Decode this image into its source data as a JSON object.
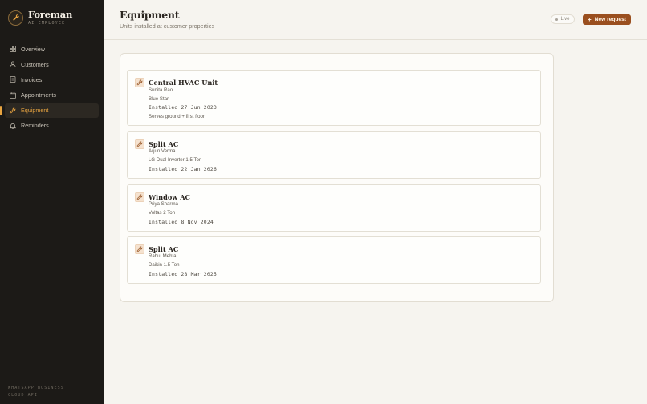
{
  "brand": {
    "name": "Foreman",
    "tagline": "AI EMPLOYEE"
  },
  "nav": [
    {
      "label": "Overview",
      "icon": "grid-icon",
      "active": false
    },
    {
      "label": "Customers",
      "icon": "user-icon",
      "active": false
    },
    {
      "label": "Invoices",
      "icon": "invoice-icon",
      "active": false
    },
    {
      "label": "Appointments",
      "icon": "calendar-icon",
      "active": false
    },
    {
      "label": "Equipment",
      "icon": "wrench-icon",
      "active": true
    },
    {
      "label": "Reminders",
      "icon": "bell-icon",
      "active": false
    }
  ],
  "footer": {
    "line1": "WHATSAPP BUSINESS",
    "line2": "CLOUD API"
  },
  "header": {
    "title": "Equipment",
    "subtitle": "Units installed at customer properties",
    "live_label": "Live",
    "new_request_label": "New request"
  },
  "equipment": [
    {
      "name": "Central HVAC Unit",
      "customer": "Sunita Rao",
      "model": "Blue Star",
      "installed": "Installed 27 Jun 2023",
      "note": "Serves ground + first floor"
    },
    {
      "name": "Split AC",
      "customer": "Arjun Verma",
      "model": "LG Dual Inverter 1.5 Ton",
      "installed": "Installed 22 Jan 2026",
      "note": ""
    },
    {
      "name": "Window AC",
      "customer": "Priya Sharma",
      "model": "Voltas 2 Ton",
      "installed": "Installed 8 Nov 2024",
      "note": ""
    },
    {
      "name": "Split AC",
      "customer": "Rahul Mehta",
      "model": "Daikin 1.5 Ton",
      "installed": "Installed 28 Mar 2025",
      "note": ""
    }
  ],
  "colors": {
    "accent": "#e8a440",
    "button": "#9a4f1f",
    "sidebar": "#1c1a17"
  }
}
